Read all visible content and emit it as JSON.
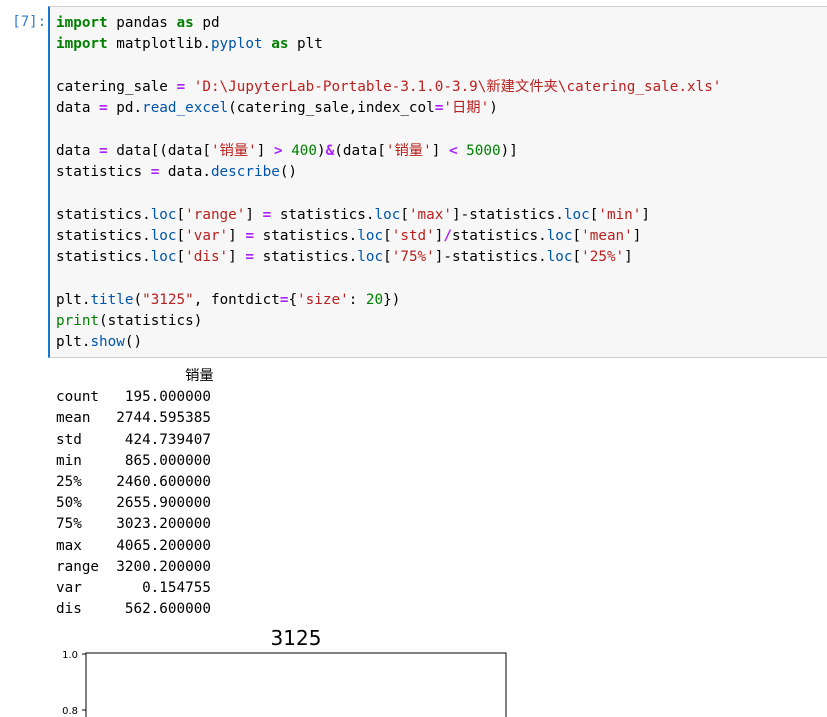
{
  "cell": {
    "prompt": "[7]:",
    "code": {
      "l1": {
        "k1": "import",
        "t1": " pandas ",
        "k2": "as",
        "t2": " pd"
      },
      "l2": {
        "k1": "import",
        "t1": " matplotlib.",
        "f1": "pyplot",
        "t2": " ",
        "k2": "as",
        "t3": " plt"
      },
      "l4": {
        "t1": "catering_sale ",
        "o1": "=",
        "t2": " ",
        "s1": "'D:\\JupyterLab-Portable-3.1.0-3.9\\新建文件夹\\catering_sale.xls'"
      },
      "l5": {
        "t1": "data ",
        "o1": "=",
        "t2": " pd.",
        "f1": "read_excel",
        "t3": "(catering_sale,index_col",
        "o2": "=",
        "s1": "'日期'",
        "t4": ")"
      },
      "l7": {
        "t1": "data ",
        "o1": "=",
        "t2": " data[(data[",
        "s1": "'销量'",
        "t3": "] ",
        "o2": ">",
        "t4": " ",
        "n1": "400",
        "t5": ")",
        "o3": "&",
        "t6": "(data[",
        "s2": "'销量'",
        "t7": "] ",
        "o4": "<",
        "t8": " ",
        "n2": "5000",
        "t9": ")]"
      },
      "l8": {
        "t1": "statistics ",
        "o1": "=",
        "t2": " data.",
        "f1": "describe",
        "t3": "()"
      },
      "l10": {
        "t1": "statistics.",
        "f1": "loc",
        "t2": "[",
        "s1": "'range'",
        "t3": "] ",
        "o1": "=",
        "t4": " statistics.",
        "f2": "loc",
        "t5": "[",
        "s2": "'max'",
        "t6": "]-statistics.",
        "f3": "loc",
        "t7": "[",
        "s3": "'min'",
        "t8": "]"
      },
      "l11": {
        "t1": "statistics.",
        "f1": "loc",
        "t2": "[",
        "s1": "'var'",
        "t3": "] ",
        "o1": "=",
        "t4": " statistics.",
        "f2": "loc",
        "t5": "[",
        "s2": "'std'",
        "t6": "]",
        "o2": "/",
        "t7": "statistics.",
        "f3": "loc",
        "t8": "[",
        "s3": "'mean'",
        "t9": "]"
      },
      "l12": {
        "t1": "statistics.",
        "f1": "loc",
        "t2": "[",
        "s1": "'dis'",
        "t3": "] ",
        "o1": "=",
        "t4": " statistics.",
        "f2": "loc",
        "t5": "[",
        "s2": "'75%'",
        "t6": "]-statistics.",
        "f3": "loc",
        "t7": "[",
        "s3": "'25%'",
        "t8": "]"
      },
      "l14": {
        "t1": "plt.",
        "f1": "title",
        "t2": "(",
        "s1": "\"3125\"",
        "t3": ", fontdict",
        "o1": "=",
        "t4": "{",
        "s2": "'size'",
        "t5": ": ",
        "n1": "20",
        "t6": "})"
      },
      "l15": {
        "b1": "print",
        "t1": "(statistics)"
      },
      "l16": {
        "t1": "plt.",
        "f1": "show",
        "t2": "()"
      }
    }
  },
  "output": {
    "header": "               销量",
    "rows": [
      "count   195.000000",
      "mean   2744.595385",
      "std     424.739407",
      "min     865.000000",
      "25%    2460.600000",
      "50%    2655.900000",
      "75%    3023.200000",
      "max    4065.200000",
      "range  3200.200000",
      "var       0.154755",
      "dis     562.600000"
    ]
  },
  "chart_data": {
    "type": "line",
    "title": "3125",
    "series": [],
    "yticks": [
      "1.0",
      "0.8"
    ],
    "ylim": [
      0.8,
      1.0
    ]
  }
}
